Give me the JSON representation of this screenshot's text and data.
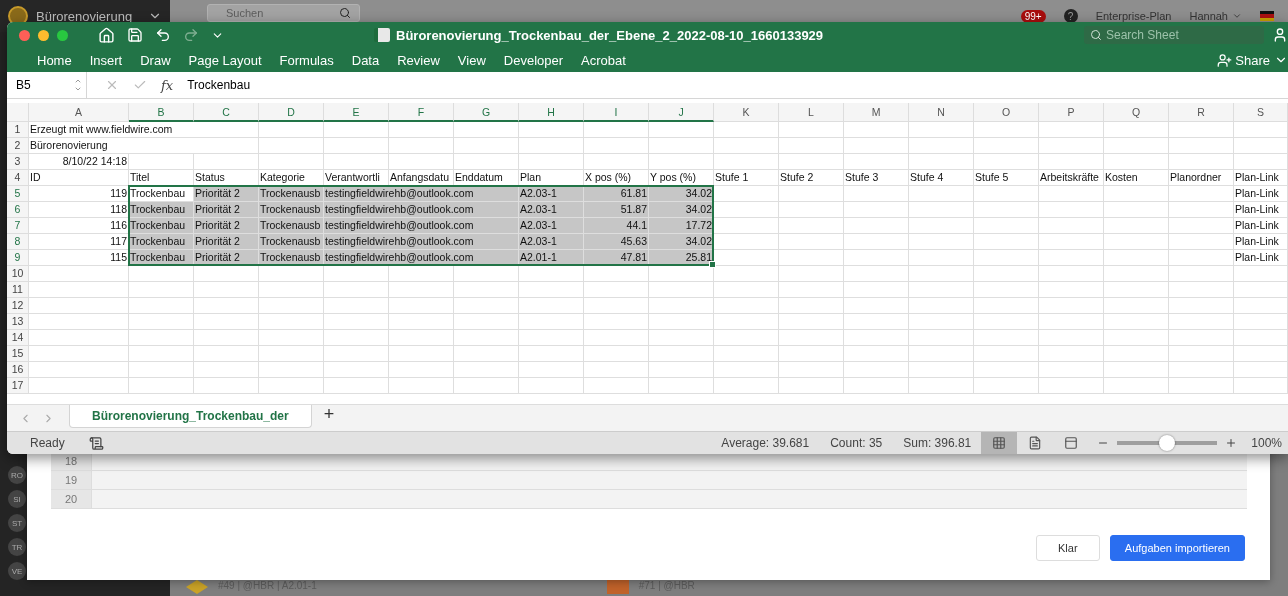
{
  "background_app": {
    "project": "Bürorenovierung",
    "search": {
      "placeholder": "Suchen"
    },
    "notifications": "99+",
    "help": "?",
    "plan": "Enterprise-Plan",
    "user": "Hannah",
    "sidebar_avatars": [
      "RO",
      "SI",
      "ST",
      "TR",
      "VE"
    ],
    "task_cards": [
      {
        "meta": "#49 | @HBR | A2.01-1",
        "color": "#c9a227"
      },
      {
        "meta": "#71 | @HBR",
        "color": "#c0622a"
      }
    ]
  },
  "import_dialog": {
    "preview_rows": [
      "18",
      "19",
      "20"
    ],
    "buttons": [
      {
        "label": "Klar",
        "kind": "secondary"
      },
      {
        "label": "Aufgaben importieren",
        "kind": "primary"
      }
    ]
  },
  "excel": {
    "title": "Bürorenovierung_Trockenbau_der_Ebene_2_2022-08-10_1660133929",
    "search": {
      "placeholder": "Search Sheet"
    },
    "ribbon_tabs": [
      "Home",
      "Insert",
      "Draw",
      "Page Layout",
      "Formulas",
      "Data",
      "Review",
      "View",
      "Developer",
      "Acrobat"
    ],
    "share": "Share",
    "name_box": "B5",
    "fx": "fx",
    "formula": "Trockenbau",
    "columns": [
      "A",
      "B",
      "C",
      "D",
      "E",
      "F",
      "G",
      "H",
      "I",
      "J",
      "K",
      "L",
      "M",
      "N",
      "O",
      "P",
      "Q",
      "R",
      "S"
    ],
    "rows": [
      {
        "number": "1",
        "cells": {
          "A": {
            "text": "Erzeugt mit www.fieldwire.com",
            "selected": false
          }
        }
      },
      {
        "number": "2",
        "cells": {
          "A": {
            "text": "Bürorenovierung",
            "selected": false
          }
        }
      },
      {
        "number": "3",
        "cells": {
          "A": {
            "text": "8/10/22 14:18",
            "numeric": true,
            "selected": false
          }
        }
      },
      {
        "number": "4",
        "cells": {
          "A": {
            "text": "ID",
            "selected": false
          },
          "B": {
            "text": "Titel",
            "selected": false
          },
          "C": {
            "text": "Status",
            "selected": false
          },
          "D": {
            "text": "Kategorie",
            "selected": false
          },
          "E": {
            "text": "Verantwortli",
            "selected": false
          },
          "F": {
            "text": "Anfangsdatu",
            "selected": false
          },
          "G": {
            "text": "Enddatum",
            "selected": false
          },
          "H": {
            "text": "Plan",
            "selected": false
          },
          "I": {
            "text": "X pos (%)",
            "selected": false
          },
          "J": {
            "text": "Y pos (%)",
            "selected": false
          },
          "K": {
            "text": "Stufe 1",
            "selected": false
          },
          "L": {
            "text": "Stufe 2",
            "selected": false
          },
          "M": {
            "text": "Stufe 3",
            "selected": false
          },
          "N": {
            "text": "Stufe 4",
            "selected": false
          },
          "O": {
            "text": "Stufe 5",
            "selected": false
          },
          "P": {
            "text": "Arbeitskräfte",
            "selected": false
          },
          "Q": {
            "text": "Kosten",
            "selected": false
          },
          "R": {
            "text": "Planordner",
            "selected": false
          },
          "S": {
            "text": "Plan-Link",
            "selected": false
          }
        }
      },
      {
        "number": "5",
        "cells": {
          "A": {
            "text": "119",
            "numeric": true,
            "selected": false
          },
          "B": {
            "text": "Trockenbau",
            "selected": false,
            "active": true
          },
          "C": {
            "text": "Priorität 2",
            "selected": true
          },
          "D": {
            "text": "Trockenausb",
            "selected": true
          },
          "E": {
            "text": "testingfieldwirehb@outlook.com",
            "selected": true
          },
          "H": {
            "text": "A2.03-1",
            "selected": true
          },
          "I": {
            "text": "61.81",
            "numeric": true,
            "selected": true
          },
          "J": {
            "text": "34.02",
            "numeric": true,
            "selected": true
          },
          "S": {
            "text": "Plan-Link",
            "selected": false
          }
        }
      },
      {
        "number": "6",
        "cells": {
          "A": {
            "text": "118",
            "numeric": true,
            "selected": false
          },
          "B": {
            "text": "Trockenbau",
            "selected": true
          },
          "C": {
            "text": "Priorität 2",
            "selected": true
          },
          "D": {
            "text": "Trockenausb",
            "selected": true
          },
          "E": {
            "text": "testingfieldwirehb@outlook.com",
            "selected": true
          },
          "H": {
            "text": "A2.03-1",
            "selected": true
          },
          "I": {
            "text": "51.87",
            "numeric": true,
            "selected": true
          },
          "J": {
            "text": "34.02",
            "numeric": true,
            "selected": true
          },
          "S": {
            "text": "Plan-Link",
            "selected": false
          }
        }
      },
      {
        "number": "7",
        "cells": {
          "A": {
            "text": "116",
            "numeric": true,
            "selected": false
          },
          "B": {
            "text": "Trockenbau",
            "selected": true
          },
          "C": {
            "text": "Priorität 2",
            "selected": true
          },
          "D": {
            "text": "Trockenausb",
            "selected": true
          },
          "E": {
            "text": "testingfieldwirehb@outlook.com",
            "selected": true
          },
          "H": {
            "text": "A2.03-1",
            "selected": true
          },
          "I": {
            "text": "44.1",
            "numeric": true,
            "selected": true
          },
          "J": {
            "text": "17.72",
            "numeric": true,
            "selected": true
          },
          "S": {
            "text": "Plan-Link",
            "selected": false
          }
        }
      },
      {
        "number": "8",
        "cells": {
          "A": {
            "text": "117",
            "numeric": true,
            "selected": false
          },
          "B": {
            "text": "Trockenbau",
            "selected": true
          },
          "C": {
            "text": "Priorität 2",
            "selected": true
          },
          "D": {
            "text": "Trockenausb",
            "selected": true
          },
          "E": {
            "text": "testingfieldwirehb@outlook.com",
            "selected": true
          },
          "H": {
            "text": "A2.03-1",
            "selected": true
          },
          "I": {
            "text": "45.63",
            "numeric": true,
            "selected": true
          },
          "J": {
            "text": "34.02",
            "numeric": true,
            "selected": true
          },
          "S": {
            "text": "Plan-Link",
            "selected": false
          }
        }
      },
      {
        "number": "9",
        "cells": {
          "A": {
            "text": "115",
            "numeric": true,
            "selected": false
          },
          "B": {
            "text": "Trockenbau",
            "selected": true
          },
          "C": {
            "text": "Priorität 2",
            "selected": true
          },
          "D": {
            "text": "Trockenausb",
            "selected": true
          },
          "E": {
            "text": "testingfieldwirehb@outlook.com",
            "selected": true
          },
          "H": {
            "text": "A2.01-1",
            "selected": true
          },
          "I": {
            "text": "47.81",
            "numeric": true,
            "selected": true
          },
          "J": {
            "text": "25.81",
            "numeric": true,
            "selected": true
          },
          "S": {
            "text": "Plan-Link",
            "selected": false
          }
        }
      },
      {
        "number": "10",
        "cells": {}
      },
      {
        "number": "11",
        "cells": {}
      },
      {
        "number": "12",
        "cells": {}
      },
      {
        "number": "13",
        "cells": {}
      },
      {
        "number": "14",
        "cells": {}
      },
      {
        "number": "15",
        "cells": {}
      },
      {
        "number": "16",
        "cells": {}
      },
      {
        "number": "17",
        "cells": {}
      }
    ],
    "sheet_tabs": [
      {
        "label": "Bürorenovierung_Trockenbau_der",
        "selected": true
      }
    ],
    "add_sheet": "+",
    "status": "Ready",
    "stats": [
      "Average: 39.681",
      "Count: 35",
      "Sum: 396.81"
    ],
    "views": [
      {
        "kind": "normal",
        "selected": true
      },
      {
        "kind": "page_layout",
        "selected": false
      },
      {
        "kind": "page_break",
        "selected": false
      }
    ],
    "zoom": {
      "level": 0.5,
      "reading": "100%"
    }
  }
}
